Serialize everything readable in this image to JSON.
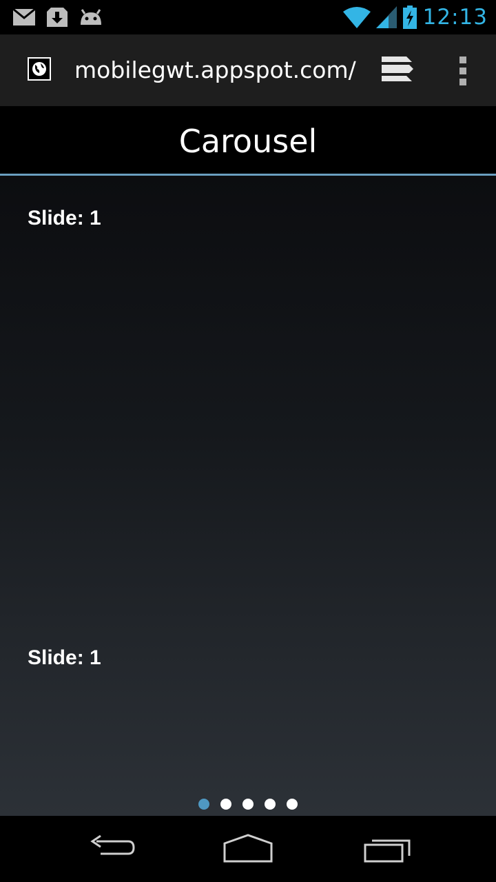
{
  "status_bar": {
    "time": "12:13",
    "notification_icons": [
      "gmail-icon",
      "download-icon",
      "android-debug-icon"
    ],
    "system_icons": [
      "wifi-icon",
      "signal-icon",
      "battery-charging-icon"
    ],
    "accent_color": "#33b5e5"
  },
  "browser": {
    "url": "mobilegwt.appspot.com/",
    "favicon": "globe-icon",
    "tabs_icon": "tabs-icon",
    "menu_icon": "overflow-menu-icon"
  },
  "app_header": {
    "title": "Carousel",
    "accent_color": "#6a9fc0"
  },
  "carousel": {
    "slides": [
      {
        "label": "Slide: 1"
      },
      {
        "label": "Slide: 1"
      }
    ],
    "page_count": 5,
    "active_page": 1,
    "active_color": "#4f98c2"
  },
  "nav_bar": {
    "buttons": [
      "back-icon",
      "home-icon",
      "recent-apps-icon"
    ]
  }
}
